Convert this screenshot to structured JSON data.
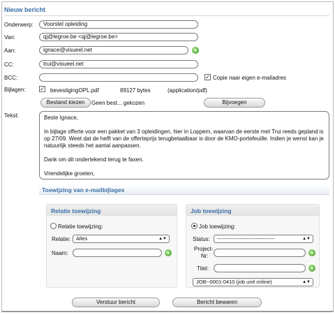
{
  "page": {
    "title": "Nieuw bericht"
  },
  "form": {
    "onderwerp": {
      "label": "Onderwerp:",
      "value": "Voorstel opleiding"
    },
    "van": {
      "label": "Van:",
      "value": "qj@legroe.be <qj@legroe.be>"
    },
    "aan": {
      "label": "Aan:",
      "value": "ignace@visueel.net"
    },
    "cc": {
      "label": "CC:",
      "value": "trui@visueel.net"
    },
    "bcc": {
      "label": "BCC:",
      "value": ""
    },
    "copy": {
      "label": "Copie naar eigen e-mailadres",
      "checked": true
    },
    "bijlagen": {
      "label": "Bijlagen:",
      "file": {
        "name": "bevestigingOPL.pdf",
        "size": "89127 bytes",
        "type": "(application/pdf)",
        "checked": true
      },
      "choose_button": "Bestand kiezen",
      "no_file": "Geen best... gekozen",
      "add_button": "Bijvoegen"
    },
    "tekst": {
      "label": "Tekst:",
      "paragraphs": [
        "Beste Ignace,",
        "In bijlage offerte voor een pakket van 3 opleidingen, hier in Loppem, waarvan de eerste met Trui reeds gepland is op 27/09.  Weet dat de helft van de offerteprijs terugbetaalbaar is door de KMO-portefeuille.  Indien je wenst kan je natuurlijk steeds het aantal aanpassen.",
        "Dank om dit ondertekend terug te faxen.",
        "Vriendelijke groeten,"
      ]
    }
  },
  "assign": {
    "title": "Toewijzing van e-mailbijlages",
    "relatie": {
      "title": "Relatie toewijzing",
      "radio_label": "Relatie toewijzing:",
      "radio_selected": false,
      "relatie_label": "Relatie:",
      "relatie_value": "Alles",
      "naam_label": "Naam:",
      "naam_value": ""
    },
    "job": {
      "title": "Job toewijzing",
      "radio_label": "Job toewijzing:",
      "radio_selected": true,
      "status_label": "Status:",
      "status_value": "---------------------------------",
      "project_label_1": "Project-",
      "project_label_2": "Nr:",
      "project_value": "",
      "titel_label": "Titel:",
      "titel_value": "",
      "job_value": "JOB--0001-0410 (job unit online)"
    }
  },
  "actions": {
    "send": "Verstuur bericht",
    "save": "Bericht bewaren"
  },
  "colors": {
    "accent": "#3a6fa8",
    "plus": "#3a9a22"
  }
}
